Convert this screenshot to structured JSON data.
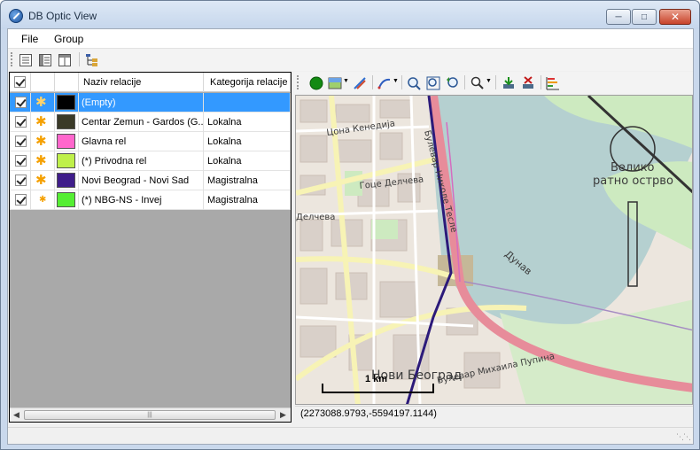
{
  "window": {
    "title": "DB Optic View"
  },
  "menu": {
    "file": "File",
    "group": "Group"
  },
  "grid": {
    "columns": {
      "name": "Naziv relacije",
      "category": "Kategorija relacije"
    },
    "rows": [
      {
        "name": "(Empty)",
        "category": "",
        "color": "#000000",
        "selected": true,
        "icon": "flower-icon"
      },
      {
        "name": "Centar Zemun - Gardos (G...",
        "category": "Lokalna",
        "color": "#3a3a28",
        "selected": false,
        "icon": "flower-icon"
      },
      {
        "name": "Glavna rel",
        "category": "Lokalna",
        "color": "#ff66cc",
        "selected": false,
        "icon": "flower-icon"
      },
      {
        "name": "(*) Privodna rel",
        "category": "Lokalna",
        "color": "#bff04a",
        "selected": false,
        "icon": "flower-icon"
      },
      {
        "name": "Novi Beograd - Novi Sad",
        "category": "Magistralna",
        "color": "#3f1d8a",
        "selected": false,
        "icon": "flower-icon"
      },
      {
        "name": "(*) NBG-NS - Invej",
        "category": "Magistralna",
        "color": "#55ee33",
        "selected": false,
        "icon": "small-flower-icon"
      }
    ]
  },
  "map": {
    "streets": [
      "Цона Кенедија",
      "Гоце Делчева",
      "Делчева",
      "Булевар Николе Тесле",
      "Булевар Михаила Пупина",
      "Дунав"
    ],
    "island": [
      "Велико",
      "ратно острво"
    ],
    "district": "Нови Београд",
    "scale_label": "1 km",
    "coordinates": "(2273088.9793,-5594197.1144)"
  },
  "colors": {
    "selection": "#3399ff",
    "route_main": "#2c1a7a",
    "route_pink": "#e78c9a",
    "water": "#b5d0d0",
    "park": "#cdeac0"
  }
}
